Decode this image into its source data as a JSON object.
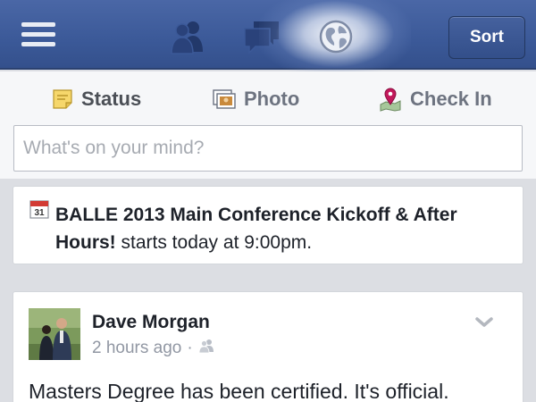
{
  "topbar": {
    "menu_icon": "hamburger-menu-icon",
    "nav_items": [
      {
        "icon": "friends-icon"
      },
      {
        "icon": "messages-icon"
      },
      {
        "icon": "globe-notifications-icon",
        "active": true
      }
    ],
    "sort_label": "Sort",
    "colors": {
      "bar": "#3b5998",
      "bar_border": "#2b4170"
    }
  },
  "composer": {
    "tabs": [
      {
        "label": "Status",
        "icon": "status-note-icon",
        "active": true
      },
      {
        "label": "Photo",
        "icon": "photo-icon"
      },
      {
        "label": "Check In",
        "icon": "map-pin-icon"
      }
    ],
    "placeholder": "What's on your mind?",
    "value": ""
  },
  "event": {
    "icon": "calendar-icon",
    "calendar_day": "31",
    "title": "BALLE 2013 Main Conference Kickoff & After Hours!",
    "suffix": " starts today at 9:00pm."
  },
  "post": {
    "author": "Dave Morgan",
    "timestamp": "2 hours ago",
    "separator": "·",
    "audience_icon": "friends-audience-icon",
    "text": "Masters Degree has been certified. It's official."
  }
}
